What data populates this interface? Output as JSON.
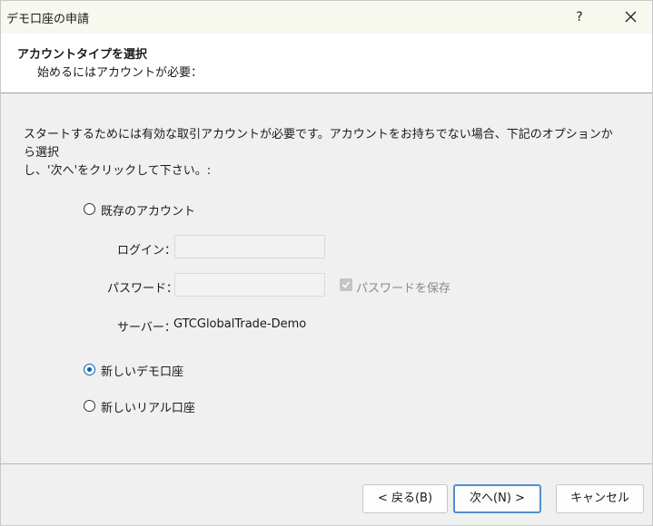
{
  "window": {
    "title": "デモ口座の申請",
    "help_label": "?"
  },
  "header": {
    "title": "アカウントタイプを選択",
    "subtitle": "始めるにはアカウントが必要："
  },
  "intro": {
    "line1": "スタートするためには有効な取引アカウントが必要です。アカウントをお持ちでない場合、下記のオプションから選択",
    "line2": "し、'次へ'をクリックして下さい。:"
  },
  "options": {
    "existing": {
      "label": "既存のアカウント",
      "checked": false
    },
    "new_demo": {
      "label": "新しいデモ口座",
      "checked": true
    },
    "new_real": {
      "label": "新しいリアル口座",
      "checked": false
    }
  },
  "login": {
    "label": "ログイン：",
    "value": ""
  },
  "password": {
    "label": "パスワード：",
    "value": "",
    "save_label": "パスワードを保存",
    "save_checked": true
  },
  "server": {
    "label": "サーバー：",
    "value": "GTCGlobalTrade-Demo"
  },
  "buttons": {
    "back": "< 戻る(B)",
    "next": "次へ(N) >",
    "cancel": "キャンセル"
  },
  "colors": {
    "accent": "#0a5fb4",
    "titlebar": "#f7f8ee"
  }
}
